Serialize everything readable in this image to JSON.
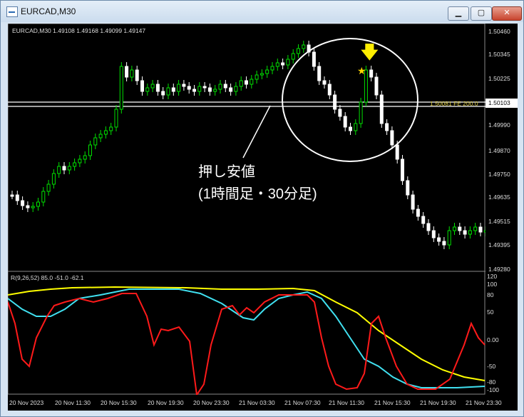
{
  "window": {
    "title": "EURCAD,M30",
    "minimize_glyph": "▁",
    "maximize_glyph": "▢",
    "close_glyph": "✕"
  },
  "chart": {
    "symbol_info": "EURCAD,M30  1.49108 1.49168 1.49099 1.49147",
    "line_label": "1.50081 FE 200.0",
    "line_price": "1.50103",
    "annotation_line1": "押し安値",
    "annotation_line2": "(1時間足・30分足)",
    "price_ticks": [
      "1.50460",
      "1.50345",
      "1.50225",
      "1.50103",
      "1.49990",
      "1.49870",
      "1.49750",
      "1.49635",
      "1.49515",
      "1.49395",
      "1.49280"
    ],
    "time_ticks": [
      "20 Nov 2023",
      "20 Nov 11:30",
      "20 Nov 15:30",
      "20 Nov 19:30",
      "20 Nov 23:30",
      "21 Nov 03:30",
      "21 Nov 07:30",
      "21 Nov 11:30",
      "21 Nov 15:30",
      "21 Nov 19:30",
      "21 Nov 23:30"
    ]
  },
  "indicator": {
    "label": "R(9,26,52) 85.0 -51.0 -62.1",
    "ticks": [
      "120",
      "100",
      "80",
      "50",
      "0.00",
      "-50",
      "-80",
      "-100"
    ]
  },
  "colors": {
    "bull": "#00e000",
    "bear": "#ffffff",
    "red": "#ff1a1a",
    "yellow": "#ffff00",
    "cyan": "#40e0f0"
  }
}
